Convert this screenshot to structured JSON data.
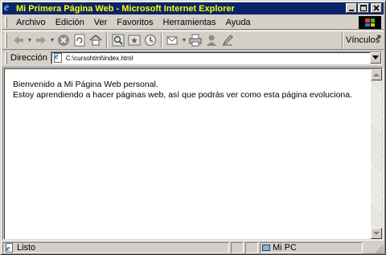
{
  "window": {
    "title": "Mi Primera Página Web - Microsoft Internet Explorer",
    "title_color": "#ffff00",
    "titlebar_color": "#0a246a"
  },
  "menu": {
    "items": [
      {
        "label": "Archivo"
      },
      {
        "label": "Edición"
      },
      {
        "label": "Ver"
      },
      {
        "label": "Favoritos"
      },
      {
        "label": "Herramientas"
      },
      {
        "label": "Ayuda"
      }
    ]
  },
  "toolbar": {
    "links_label": "Vínculos",
    "icons": [
      "back-icon",
      "forward-icon",
      "stop-icon",
      "refresh-icon",
      "home-icon",
      "search-icon",
      "favorites-icon",
      "history-icon",
      "mail-icon",
      "print-icon",
      "messenger-icon",
      "edit-icon"
    ]
  },
  "address": {
    "label": "Dirección",
    "value": "C:\\cursohtml\\index.html"
  },
  "page": {
    "line1": "Bienvenido a Mi Página Web personal.",
    "line2": "Estoy aprendiendo a hacer páginas web, así que podrás ver como esta página evoluciona."
  },
  "status": {
    "text": "Listo",
    "zone": "Mi PC"
  }
}
